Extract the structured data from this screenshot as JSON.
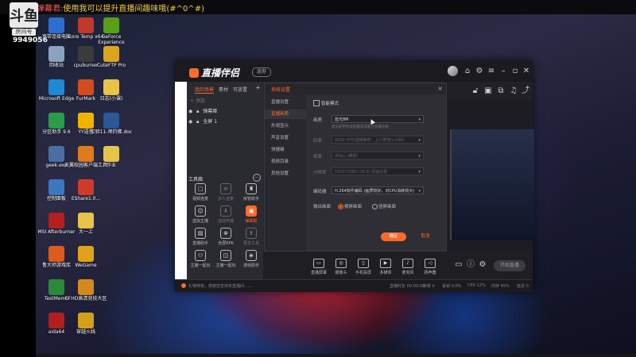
{
  "stream_overlay": {
    "username": "弹幕君:",
    "danmaku_text": "使用我可以提升直播间趣味哦(#^0^#)",
    "logo_text": "斗鱼",
    "room_badge": "房间号",
    "room_id": "9949056"
  },
  "desktop_icons": [
    {
      "label": "宽带连接电脑",
      "icon": "network-icon",
      "color": "#2d6fd1"
    },
    {
      "label": "Core Temp x64",
      "icon": "thermometer-icon",
      "color": "#c0392b"
    },
    {
      "label": "GeForce Experience",
      "icon": "nvidia-icon",
      "color": "#5a9e1a"
    },
    {
      "label": "回收站",
      "icon": "recycle-bin-icon",
      "color": "#8aa4c0"
    },
    {
      "label": "cpuburner",
      "icon": "cpu-icon",
      "color": "#3b3b3b"
    },
    {
      "label": "CuteFTP Pro",
      "icon": "ftp-icon",
      "color": "#d9a520"
    },
    {
      "label": "Microsoft Edge",
      "icon": "edge-icon",
      "color": "#1e8ad6"
    },
    {
      "label": "FurMark",
      "icon": "furmark-icon",
      "color": "#d64b1e"
    },
    {
      "label": "日志(小课)",
      "icon": "folder-icon",
      "color": "#e8c34a"
    },
    {
      "label": "分区助手 9.6",
      "icon": "partition-icon",
      "color": "#2a9d4a"
    },
    {
      "label": "YY语音",
      "icon": "yy-icon",
      "color": "#f0b400"
    },
    {
      "label": "实验11-师约佛.doc",
      "icon": "word-doc-icon",
      "color": "#2b5797"
    },
    {
      "label": "geek.exe",
      "icon": "geek-icon",
      "color": "#4a6fa5"
    },
    {
      "label": "天翼校园客户端工具",
      "icon": "campus-client-icon",
      "color": "#e07b1a"
    },
    {
      "label": "作业",
      "icon": "folder-icon",
      "color": "#e8c34a"
    },
    {
      "label": "控制面板",
      "icon": "control-panel-icon",
      "color": "#3a78c0"
    },
    {
      "label": "EShare1.0...",
      "icon": "eshare-icon",
      "color": "#d13a2a"
    },
    {
      "label": "MSI Afterburner",
      "icon": "afterburner-icon",
      "color": "#b51f1f"
    },
    {
      "label": "大一上",
      "icon": "folder-icon",
      "color": "#e8c34a"
    },
    {
      "label": "鲁大师游戏库",
      "icon": "game-library-icon",
      "color": "#e05a1a"
    },
    {
      "label": "WeGame",
      "icon": "wegame-icon",
      "color": "#e0a21a"
    },
    {
      "label": "TestMem5",
      "icon": "memory-icon",
      "color": "#2a8a3a"
    },
    {
      "label": "CFHD高清竞技大区",
      "icon": "cfhd-icon",
      "color": "#d48a1a"
    },
    {
      "label": "aida64",
      "icon": "aida64-icon",
      "color": "#b01e1e"
    },
    {
      "label": "穿越火线",
      "icon": "crossfire-icon",
      "color": "#d4a01a"
    }
  ],
  "app": {
    "name": "直播伴侣",
    "version_pill": "选你",
    "left_tabs": [
      "我的场景",
      "素材",
      "可放置"
    ],
    "add_symbol": "+",
    "scene_add": "+ 添加",
    "scenes": [
      "弹幕姬",
      "全屏 1"
    ],
    "toolbox_title": "工具箱",
    "toolbox_more": "⋯",
    "tools": [
      {
        "label": "视频连麦",
        "icon": "video-link-icon"
      },
      {
        "label": "多人连麦",
        "icon": "multi-link-icon"
      },
      {
        "label": "房管助手",
        "icon": "room-manager-icon"
      },
      {
        "label": "虚拟主播",
        "icon": "avatar-icon"
      },
      {
        "label": "虚拟开播",
        "icon": "virtual-live-icon"
      },
      {
        "label": "弹幕姬",
        "icon": "danmaku-icon"
      },
      {
        "label": "直播助手",
        "icon": "assistant-icon"
      },
      {
        "label": "全屏RPK",
        "icon": "rpk-icon"
      },
      {
        "label": "更多工具",
        "icon": "more-tools-icon"
      },
      {
        "label": "主播一起玩",
        "icon": "play-together-icon"
      },
      {
        "label": "主播一起玩",
        "icon": "play-together-2-icon"
      },
      {
        "label": "游戏助手",
        "icon": "game-helper-icon"
      }
    ],
    "bottom_buttons": [
      "直播屏幕",
      "摄像头",
      "手机投屏",
      "多媒体",
      "麦克风",
      "扬声器"
    ],
    "start_live": "开始直播",
    "status": {
      "notice": "礼物特效，感谢您支持本直播间……",
      "items": [
        "直播时长 00:00:00",
        "帧率 0",
        "丢帧 0.0%",
        "CPU 12%",
        "内存 45%",
        "延迟 0"
      ]
    }
  },
  "dialog": {
    "title": "系统设置",
    "nav": [
      "直播设置",
      "直播画质",
      "外观显示",
      "声音设置",
      "快捷键",
      "视频目录",
      "其他设置"
    ],
    "active_nav": 1,
    "smart_mode_label": "智能模式",
    "fields": [
      {
        "label": "画质",
        "value": "蓝光8M",
        "hint": "建议使用智能配置获得最佳直播效果"
      },
      {
        "label": "码率",
        "value": "8000 (FPS流畅推荐：上行带宽≥10M)",
        "hint": ""
      },
      {
        "label": "帧率",
        "value": "30fps (推荐)",
        "hint": ""
      },
      {
        "label": "分辨率",
        "value": "1920*1080 (16:9) 原画比例",
        "hint": ""
      },
      {
        "label": "编码器",
        "value": "H.264软件编码 (画质较好，对CPU消耗较大)",
        "hint": ""
      }
    ],
    "output_mode_label": "输出画面",
    "output_options": [
      "横屏画面",
      "竖屏画面"
    ],
    "ok": "确定",
    "cancel": "取消"
  }
}
